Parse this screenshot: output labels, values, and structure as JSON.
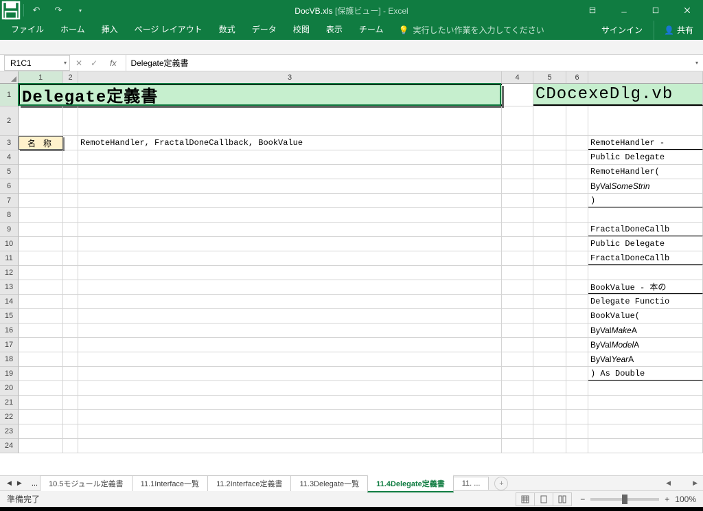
{
  "title": {
    "doc": "DocVB.xls",
    "suffix": "[保護ビュー] - Excel"
  },
  "ribbon": {
    "tabs": [
      "ファイル",
      "ホーム",
      "挿入",
      "ページ レイアウト",
      "数式",
      "データ",
      "校閲",
      "表示",
      "チーム"
    ],
    "tellme": "実行したい作業を入力してください",
    "signin": "サインイン",
    "share": "共有"
  },
  "fx": {
    "ref": "R1C1",
    "value": "Delegate定義書"
  },
  "cols": [
    "1",
    "2",
    "3",
    "4",
    "5",
    "6"
  ],
  "rows": [
    "1",
    "2",
    "3",
    "4",
    "5",
    "6",
    "7",
    "8",
    "9",
    "10",
    "11",
    "12",
    "13",
    "14",
    "15",
    "16",
    "17",
    "18",
    "19",
    "20",
    "21",
    "22",
    "23",
    "24"
  ],
  "cells": {
    "title": "Delegate定義書",
    "subtitle": "CDocexeDlg.vb",
    "name_label": "名 称",
    "names": "RemoteHandler, FractalDoneCallback, BookValue",
    "code": {
      "r3": "RemoteHandler -",
      "r4": "Public Delegate",
      "r5": "RemoteHandler(",
      "r6a": "  ByVal ",
      "r6b": "SomeStrin",
      "r7": ")",
      "r9": "FractalDoneCallb",
      "r10": "Public Delegate",
      "r11": "FractalDoneCallb",
      "r13": "BookValue - 本の",
      "r14": "Delegate Functio",
      "r15": "BookValue(",
      "r16a": "  ByVal ",
      "r16b": "Make",
      "r16c": "   A",
      "r17a": "  ByVal ",
      "r17b": "Model",
      "r17c": "  A",
      "r18a": "  ByVal ",
      "r18b": "Year",
      "r18c": "   A",
      "r19": ") As Double"
    }
  },
  "tabs": {
    "items": [
      "10.5モジュール定義書",
      "11.1Interface一覧",
      "11.2Interface定義書",
      "11.3Delegate一覧",
      "11.4Delegate定義書",
      "11. ..."
    ],
    "active": 4
  },
  "status": {
    "ready": "準備完了",
    "zoom": "100%"
  }
}
